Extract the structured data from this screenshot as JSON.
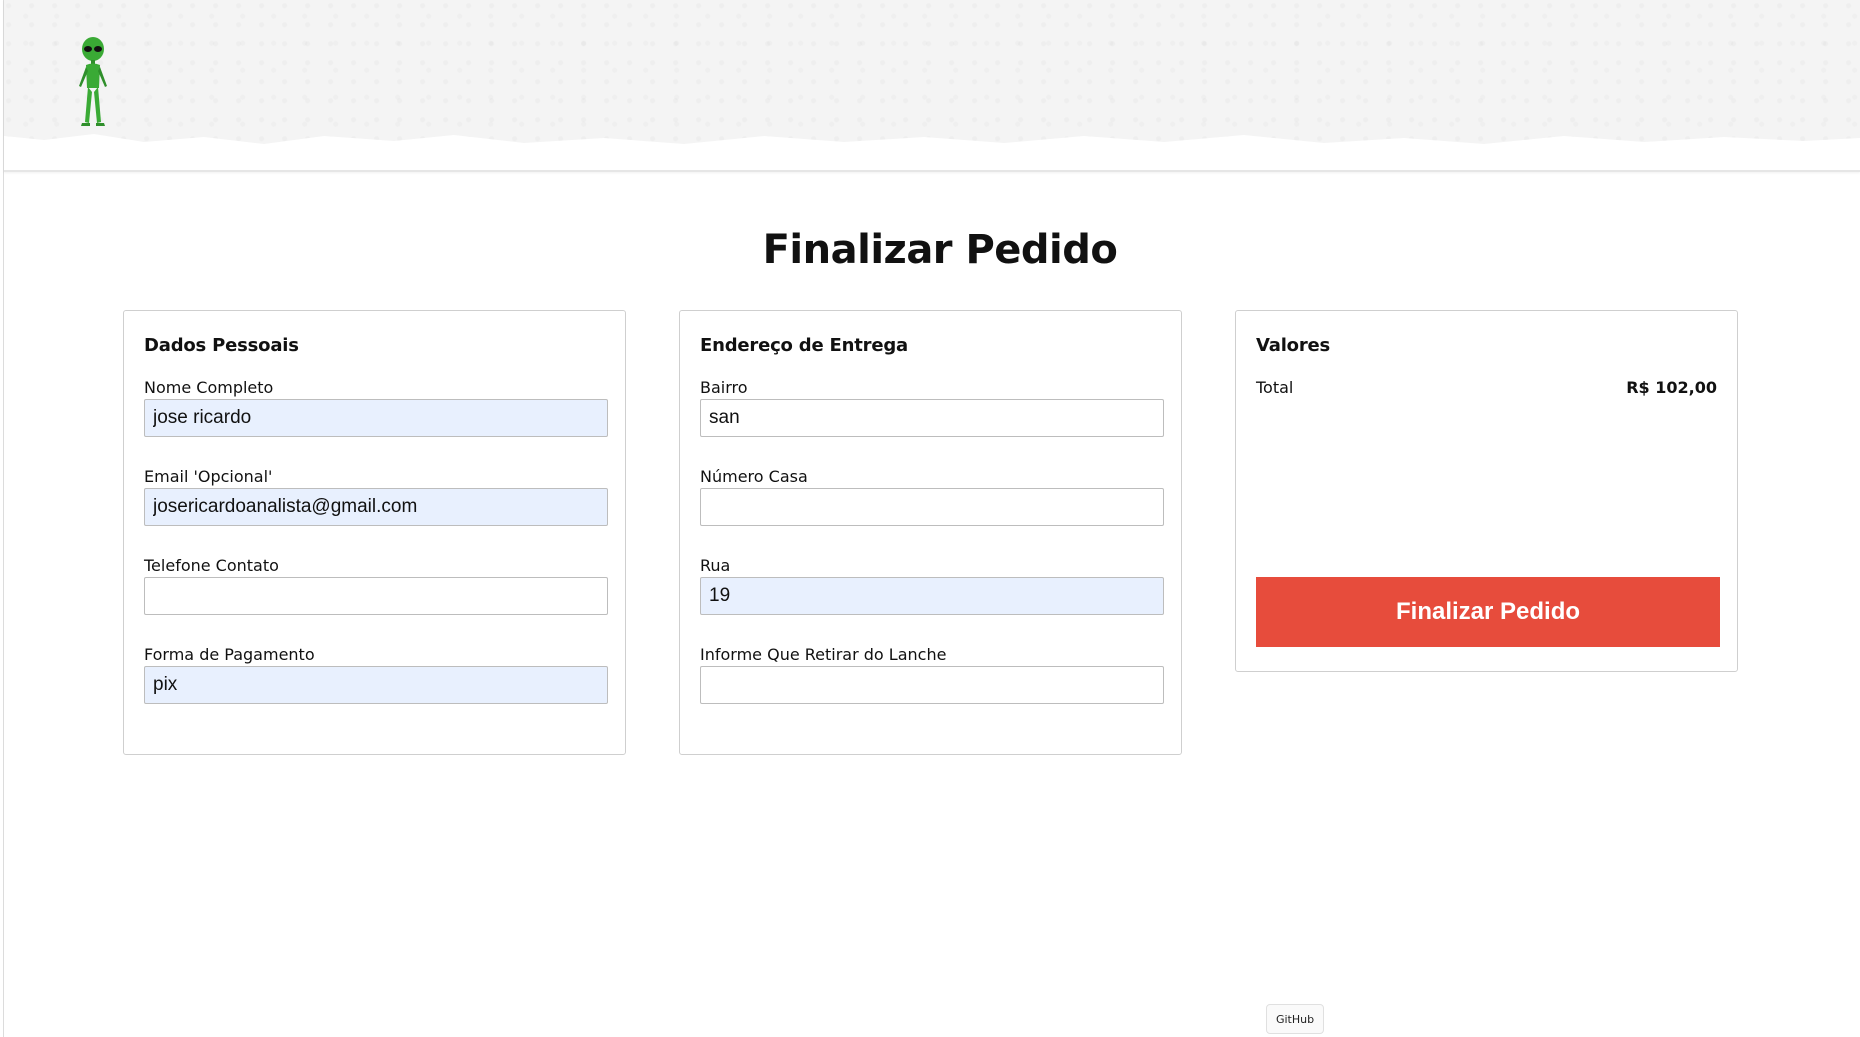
{
  "header": {
    "logo_icon": "alien-logo-icon"
  },
  "page": {
    "title": "Finalizar Pedido"
  },
  "personal": {
    "title": "Dados Pessoais",
    "fields": [
      {
        "label": "Nome Completo",
        "value": "jose ricardo",
        "filled": true
      },
      {
        "label": "Email 'Opcional'",
        "value": "josericardoanalista@gmail.com",
        "filled": true
      },
      {
        "label": "Telefone Contato",
        "value": "",
        "filled": false
      },
      {
        "label": "Forma de Pagamento",
        "value": "pix",
        "filled": true
      }
    ]
  },
  "address": {
    "title": "Endereço de Entrega",
    "fields": [
      {
        "label": "Bairro",
        "value": "san",
        "filled": false
      },
      {
        "label": "Número Casa",
        "value": "",
        "filled": false
      },
      {
        "label": "Rua",
        "value": "19",
        "filled": true
      },
      {
        "label": "Informe Que Retirar do Lanche",
        "value": "",
        "filled": false
      }
    ]
  },
  "values": {
    "title": "Valores",
    "total_label": "Total",
    "total_value": "R$ 102,00",
    "button_label": "Finalizar Pedido"
  },
  "footer": {
    "github_label": "GitHub"
  },
  "colors": {
    "accent": "#e74c3c",
    "autofill": "#e8f0fe",
    "alien": "#3aaa35"
  }
}
